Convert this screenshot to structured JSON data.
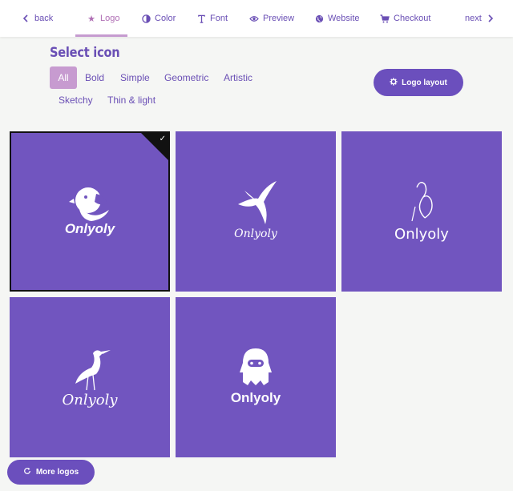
{
  "nav": {
    "back": "back",
    "logo": "Logo",
    "color": "Color",
    "font": "Font",
    "preview": "Preview",
    "website": "Website",
    "checkout": "Checkout",
    "next": "next"
  },
  "heading": "Select icon",
  "filters": [
    "All",
    "Bold",
    "Simple",
    "Geometric",
    "Artistic",
    "Sketchy",
    "Thin & light"
  ],
  "active_filter": "All",
  "layout_button": "Logo layout",
  "logos": [
    {
      "name": "Onlyoly",
      "icon": "chick-icon",
      "selected": true
    },
    {
      "name": "Onlyoly",
      "icon": "swallow-icon",
      "selected": false
    },
    {
      "name": "Onlyoly",
      "icon": "swan-line-icon",
      "selected": false
    },
    {
      "name": "Onlyoly",
      "icon": "heron-icon",
      "selected": false
    },
    {
      "name": "Onlyoly",
      "icon": "ghost-icon",
      "selected": false
    }
  ],
  "more_button": "More logos",
  "colors": {
    "accent": "#6b4fbd",
    "tile": "#7155bf",
    "active_filter": "#c79bd0",
    "active_nav": "#b06fb5"
  }
}
